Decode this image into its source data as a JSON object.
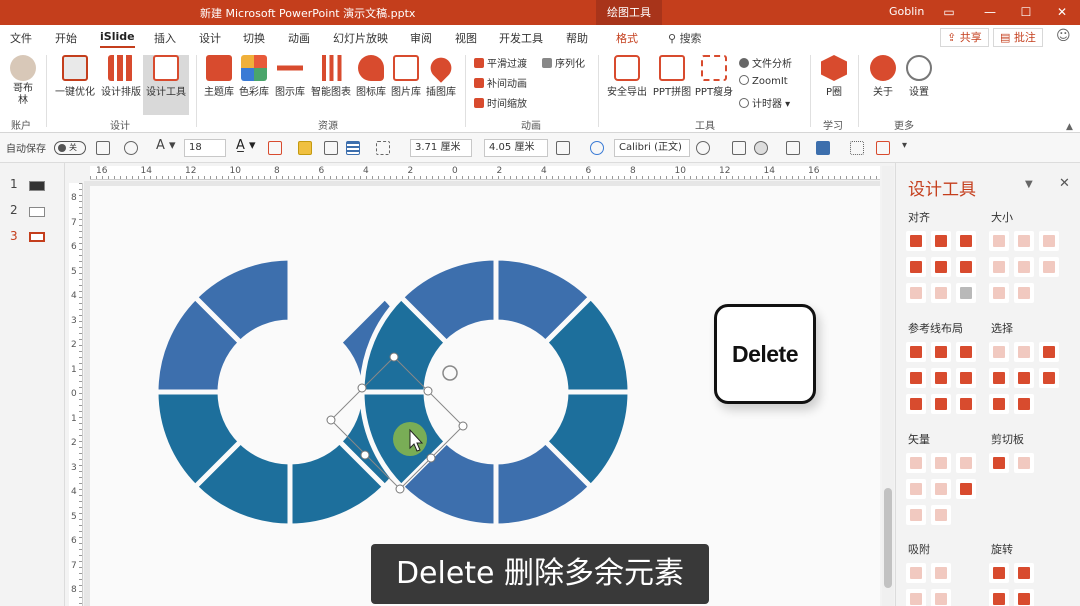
{
  "window": {
    "title": "新建 Microsoft PowerPoint 演示文稿.pptx",
    "context_tab": "绘图工具",
    "user": "Goblin",
    "accent": "#c43e1c"
  },
  "menu_tabs": [
    "文件",
    "开始",
    "iSlide",
    "插入",
    "设计",
    "切换",
    "动画",
    "幻灯片放映",
    "审阅",
    "视图",
    "开发工具",
    "帮助",
    "格式"
  ],
  "search_label": "搜索",
  "share_label": "共享",
  "comment_label": "批注",
  "ribbon": {
    "account": {
      "name": "哥布林",
      "group": "账户"
    },
    "design_group": {
      "label": "设计",
      "buttons": [
        "一键优化",
        "设计排版",
        "设计工具"
      ]
    },
    "resources_group": {
      "label": "资源",
      "buttons": [
        "主题库",
        "色彩库",
        "图示库",
        "智能图表",
        "图标库",
        "图片库",
        "插图库"
      ]
    },
    "animation_group": {
      "label": "动画",
      "items": [
        "平滑过渡",
        "序列化",
        "补间动画",
        "时间缩放"
      ]
    },
    "tools_group": {
      "label": "工具",
      "buttons": [
        "安全导出",
        "PPT拼图",
        "PPT瘦身"
      ],
      "items": [
        "文件分析",
        "ZoomIt",
        "计时器"
      ]
    },
    "learn_group": {
      "label": "学习",
      "buttons": [
        "P圈"
      ]
    },
    "more_group": {
      "label": "更多",
      "buttons": [
        "关于",
        "设置"
      ]
    }
  },
  "format_bar": {
    "autosave_label": "自动保存",
    "autosave_state": "关",
    "font_size": "18",
    "height": "3.71 厘米",
    "width": "4.05 厘米",
    "font": "Calibri (正文)"
  },
  "slides": [
    {
      "num": "1"
    },
    {
      "num": "2"
    },
    {
      "num": "3"
    }
  ],
  "ruler": {
    "h_ticks": [
      "16",
      "14",
      "12",
      "10",
      "8",
      "6",
      "4",
      "2",
      "0",
      "2",
      "4",
      "6",
      "8",
      "10",
      "12",
      "14",
      "16"
    ],
    "v_ticks": [
      "8",
      "7",
      "6",
      "5",
      "4",
      "3",
      "2",
      "1",
      "0",
      "1",
      "2",
      "3",
      "4",
      "5",
      "6",
      "7",
      "8"
    ]
  },
  "canvas": {
    "delete_key_label": "Delete",
    "subtitle": "Delete 删除多余元素",
    "ring_color_a": "#3d6fad",
    "ring_color_b": "#1d6f9c"
  },
  "panel": {
    "title": "设计工具",
    "sections": [
      "对齐",
      "大小",
      "参考线布局",
      "选择",
      "矢量",
      "剪切板",
      "吸附",
      "旋转"
    ]
  }
}
